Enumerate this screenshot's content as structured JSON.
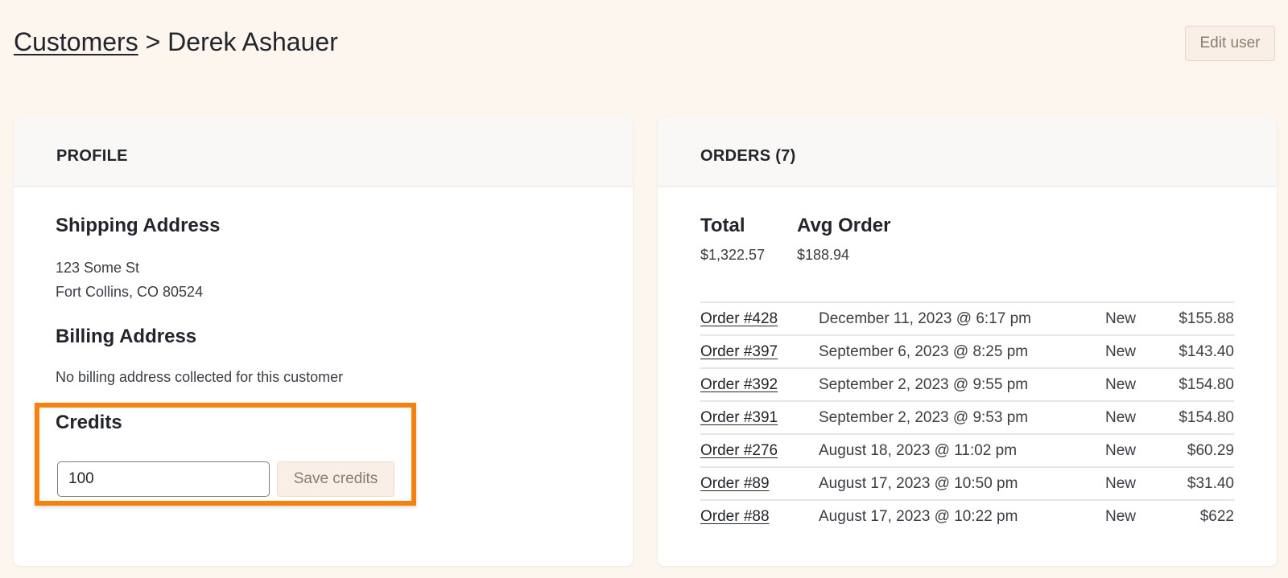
{
  "header": {
    "breadcrumb_parent": "Customers",
    "breadcrumb_separator": ">",
    "breadcrumb_current": "Derek Ashauer",
    "edit_button": "Edit user"
  },
  "profile": {
    "title": "PROFILE",
    "shipping_title": "Shipping Address",
    "shipping_line1": "123 Some St",
    "shipping_line2": "Fort Collins, CO 80524",
    "billing_title": "Billing Address",
    "billing_text": "No billing address collected for this customer",
    "credits_title": "Credits",
    "credits_value": "100",
    "save_credits_button": "Save credits",
    "highlight_color": "#f6820e"
  },
  "orders": {
    "title": "ORDERS (7)",
    "total_label": "Total",
    "total_value": "$1,322.57",
    "avg_label": "Avg Order",
    "avg_value": "$188.94",
    "rows": [
      {
        "order": "Order #428",
        "date": "December 11, 2023 @ 6:17 pm",
        "status": "New",
        "amount": "$155.88"
      },
      {
        "order": "Order #397",
        "date": "September 6, 2023 @ 8:25 pm",
        "status": "New",
        "amount": "$143.40"
      },
      {
        "order": "Order #392",
        "date": "September 2, 2023 @ 9:55 pm",
        "status": "New",
        "amount": "$154.80"
      },
      {
        "order": "Order #391",
        "date": "September 2, 2023 @ 9:53 pm",
        "status": "New",
        "amount": "$154.80"
      },
      {
        "order": "Order #276",
        "date": "August 18, 2023 @ 11:02 pm",
        "status": "New",
        "amount": "$60.29"
      },
      {
        "order": "Order #89",
        "date": "August 17, 2023 @ 10:50 pm",
        "status": "New",
        "amount": "$31.40"
      },
      {
        "order": "Order #88",
        "date": "August 17, 2023 @ 10:22 pm",
        "status": "New",
        "amount": "$622"
      }
    ]
  }
}
